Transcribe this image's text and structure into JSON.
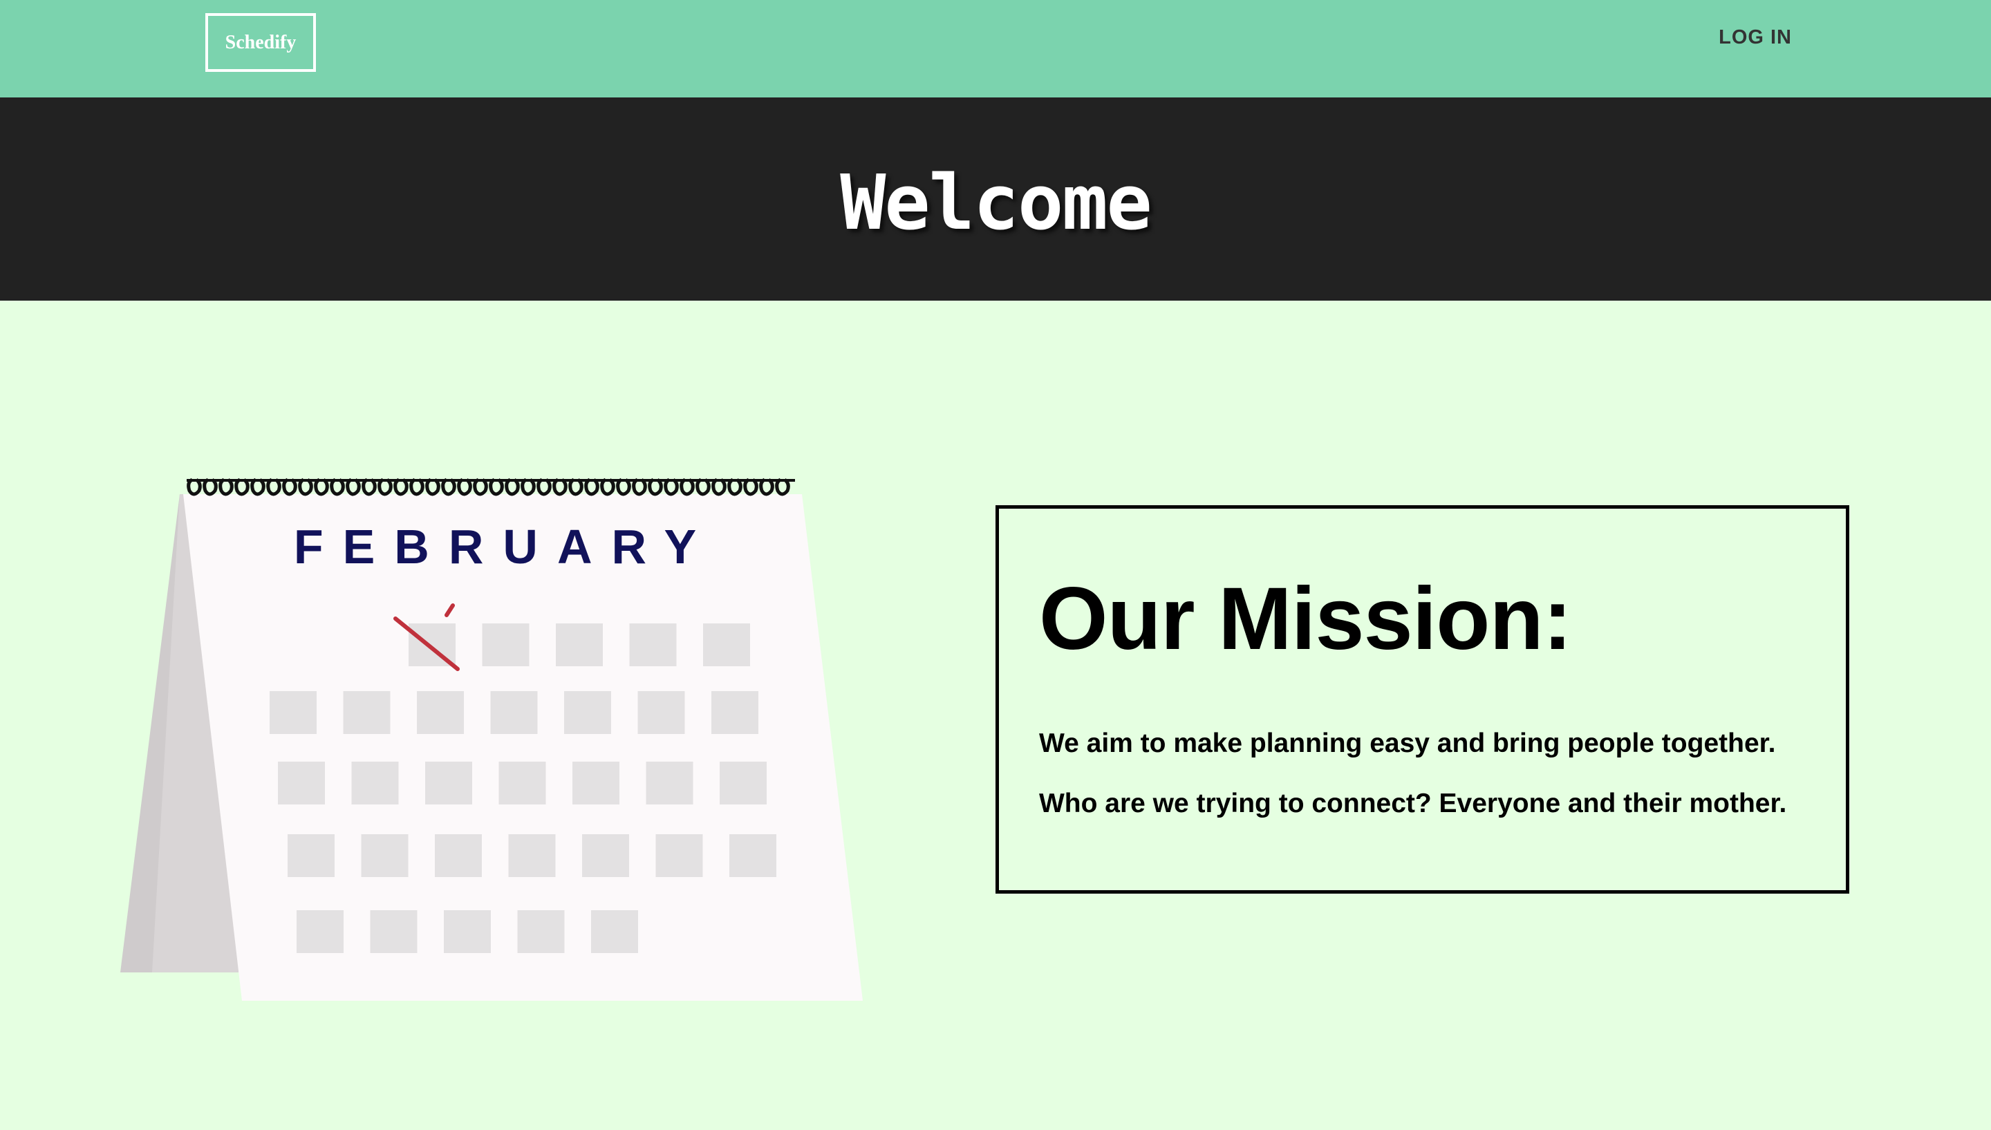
{
  "nav": {
    "brand": "Schedify",
    "login_label": "LOG IN"
  },
  "hero": {
    "title": "Welcome"
  },
  "calendar": {
    "month": "FEBRUARY",
    "icon": "desk-calendar-illustration"
  },
  "mission": {
    "heading": "Our Mission:",
    "lines": [
      "We aim to make planning easy and bring people together.",
      "Who are we trying to connect? Everyone and their mother."
    ]
  },
  "colors": {
    "navbar": "#7bd3ae",
    "hero": "#222222",
    "page_background": "#e5ffe1",
    "calendar_month": "#11125a",
    "check_mark": "#c0313c"
  }
}
